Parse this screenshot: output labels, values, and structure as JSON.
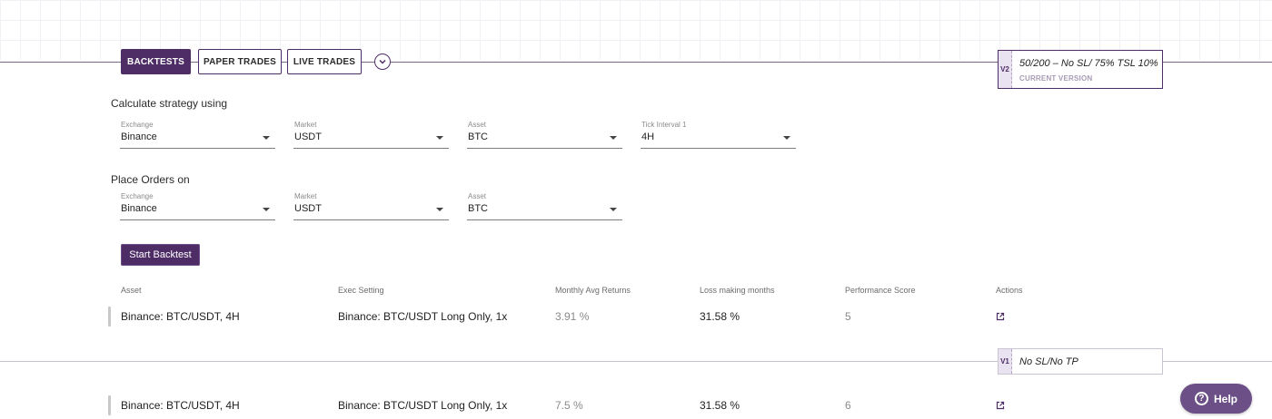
{
  "tabs": [
    {
      "label": "BACKTESTS",
      "active": true
    },
    {
      "label": "PAPER TRADES",
      "active": false
    },
    {
      "label": "LIVE TRADES",
      "active": false
    }
  ],
  "version_current": {
    "badge": "V2",
    "title": "50/200 – No SL/ 75% TSL 10%",
    "subtitle": "CURRENT VERSION"
  },
  "version_prev": {
    "badge": "V1",
    "title": "No SL/No TP"
  },
  "calculate": {
    "title": "Calculate strategy using",
    "fields": [
      {
        "label": "Exchange",
        "value": "Binance"
      },
      {
        "label": "Market",
        "value": "USDT"
      },
      {
        "label": "Asset",
        "value": "BTC"
      },
      {
        "label": "Tick Interval 1",
        "value": "4H"
      }
    ]
  },
  "place_orders": {
    "title": "Place Orders on",
    "fields": [
      {
        "label": "Exchange",
        "value": "Binance"
      },
      {
        "label": "Market",
        "value": "USDT"
      },
      {
        "label": "Asset",
        "value": "BTC"
      }
    ]
  },
  "start_button": "Start Backtest",
  "table": {
    "headers": [
      "Asset",
      "Exec Setting",
      "Monthly Avg Returns",
      "Loss making months",
      "Performance Score",
      "Actions"
    ],
    "rows": [
      {
        "asset": "Binance: BTC/USDT, 4H",
        "exec": "Binance: BTC/USDT Long Only, 1x",
        "monthly": "3.91 %",
        "loss": "31.58 %",
        "score": "5"
      },
      {
        "asset": "Binance: BTC/USDT, 4H",
        "exec": "Binance: BTC/USDT Long Only, 1x",
        "monthly": "7.5 %",
        "loss": "31.58 %",
        "score": "6"
      }
    ]
  },
  "help": {
    "label": "Help",
    "glyph": "?"
  },
  "colors": {
    "accent": "#4e2d66",
    "help": "#6b4f86"
  },
  "icons": [
    "chevron-down-icon",
    "external-link-icon",
    "help-icon"
  ]
}
